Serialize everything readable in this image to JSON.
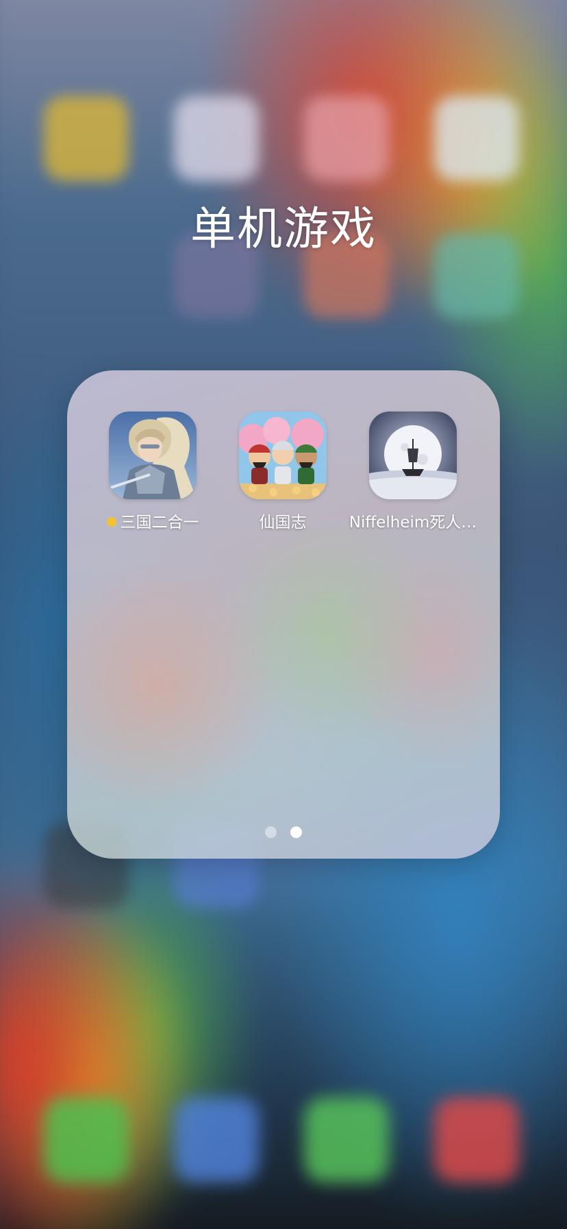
{
  "folder": {
    "title": "单机游戏",
    "apps": [
      {
        "label": "三国二合一",
        "icon": "warrior-portrait-icon",
        "has_new_badge": true
      },
      {
        "label": "仙国志",
        "icon": "three-heroes-icon",
        "has_new_badge": false
      },
      {
        "label": "Niffelheim死人…",
        "icon": "moon-ship-icon",
        "has_new_badge": false
      }
    ],
    "page_count": 2,
    "current_page": 2
  },
  "colors": {
    "new_badge": "#f2c230",
    "page_dot_active": "#ffffff",
    "page_dot_inactive": "rgba(255,255,255,0.45)"
  }
}
